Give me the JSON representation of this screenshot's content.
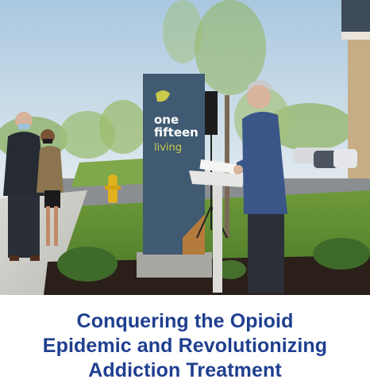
{
  "photo": {
    "description_icon": "photo-image",
    "sign": {
      "line1": "one",
      "line2": "fifteen",
      "line3": "living",
      "panel_color": "#3f5a71",
      "accent_color": "#c9c94a"
    }
  },
  "caption": {
    "line1": "Conquering the Opioid",
    "line2": "Epidemic and Revolutionizing",
    "line3": "Addiction Treatment"
  },
  "colors": {
    "caption_text": "#1f3f8f",
    "background": "#ffffff"
  }
}
